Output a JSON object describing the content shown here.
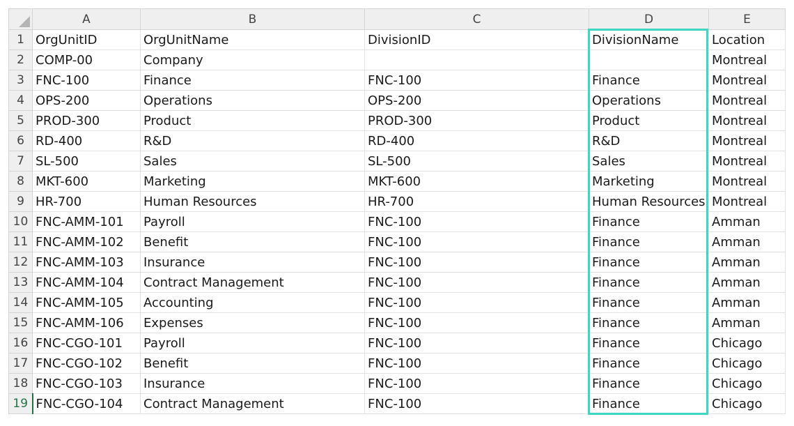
{
  "sheet": {
    "columns": [
      "A",
      "B",
      "C",
      "D",
      "E"
    ],
    "rows": [
      {
        "num": "1",
        "cells": [
          "OrgUnitID",
          "OrgUnitName",
          "DivisionID",
          "DivisionName",
          "Location"
        ]
      },
      {
        "num": "2",
        "cells": [
          "COMP-00",
          "Company",
          "",
          "",
          "Montreal"
        ]
      },
      {
        "num": "3",
        "cells": [
          "FNC-100",
          "Finance",
          "FNC-100",
          "Finance",
          "Montreal"
        ]
      },
      {
        "num": "4",
        "cells": [
          "OPS-200",
          "Operations",
          "OPS-200",
          "Operations",
          "Montreal"
        ]
      },
      {
        "num": "5",
        "cells": [
          "PROD-300",
          "Product",
          "PROD-300",
          "Product",
          "Montreal"
        ]
      },
      {
        "num": "6",
        "cells": [
          "RD-400",
          "R&D",
          "RD-400",
          "R&D",
          "Montreal"
        ]
      },
      {
        "num": "7",
        "cells": [
          "SL-500",
          "Sales",
          "SL-500",
          "Sales",
          "Montreal"
        ]
      },
      {
        "num": "8",
        "cells": [
          "MKT-600",
          "Marketing",
          "MKT-600",
          "Marketing",
          "Montreal"
        ]
      },
      {
        "num": "9",
        "cells": [
          "HR-700",
          "Human Resources",
          "HR-700",
          "Human Resources",
          "Montreal"
        ]
      },
      {
        "num": "10",
        "cells": [
          "FNC-AMM-101",
          "Payroll",
          "FNC-100",
          "Finance",
          "Amman"
        ]
      },
      {
        "num": "11",
        "cells": [
          "FNC-AMM-102",
          "Benefit",
          "FNC-100",
          "Finance",
          "Amman"
        ]
      },
      {
        "num": "12",
        "cells": [
          "FNC-AMM-103",
          "Insurance",
          "FNC-100",
          "Finance",
          "Amman"
        ]
      },
      {
        "num": "13",
        "cells": [
          "FNC-AMM-104",
          "Contract Management",
          "FNC-100",
          "Finance",
          "Amman"
        ]
      },
      {
        "num": "14",
        "cells": [
          "FNC-AMM-105",
          "Accounting",
          "FNC-100",
          "Finance",
          "Amman"
        ]
      },
      {
        "num": "15",
        "cells": [
          "FNC-AMM-106",
          "Expenses",
          "FNC-100",
          "Finance",
          "Amman"
        ]
      },
      {
        "num": "16",
        "cells": [
          "FNC-CGO-101",
          "Payroll",
          "FNC-100",
          "Finance",
          "Chicago"
        ]
      },
      {
        "num": "17",
        "cells": [
          "FNC-CGO-102",
          "Benefit",
          "FNC-100",
          "Finance",
          "Chicago"
        ]
      },
      {
        "num": "18",
        "cells": [
          "FNC-CGO-103",
          "Insurance",
          "FNC-100",
          "Finance",
          "Chicago"
        ]
      },
      {
        "num": "19",
        "cells": [
          "FNC-CGO-104",
          "Contract Management",
          "FNC-100",
          "Finance",
          "Chicago"
        ]
      }
    ],
    "active_row": "19",
    "highlight_column": "D",
    "highlight_color": "#3fd6c4",
    "header_bg": "#efefef",
    "active_header_color": "#217346"
  }
}
